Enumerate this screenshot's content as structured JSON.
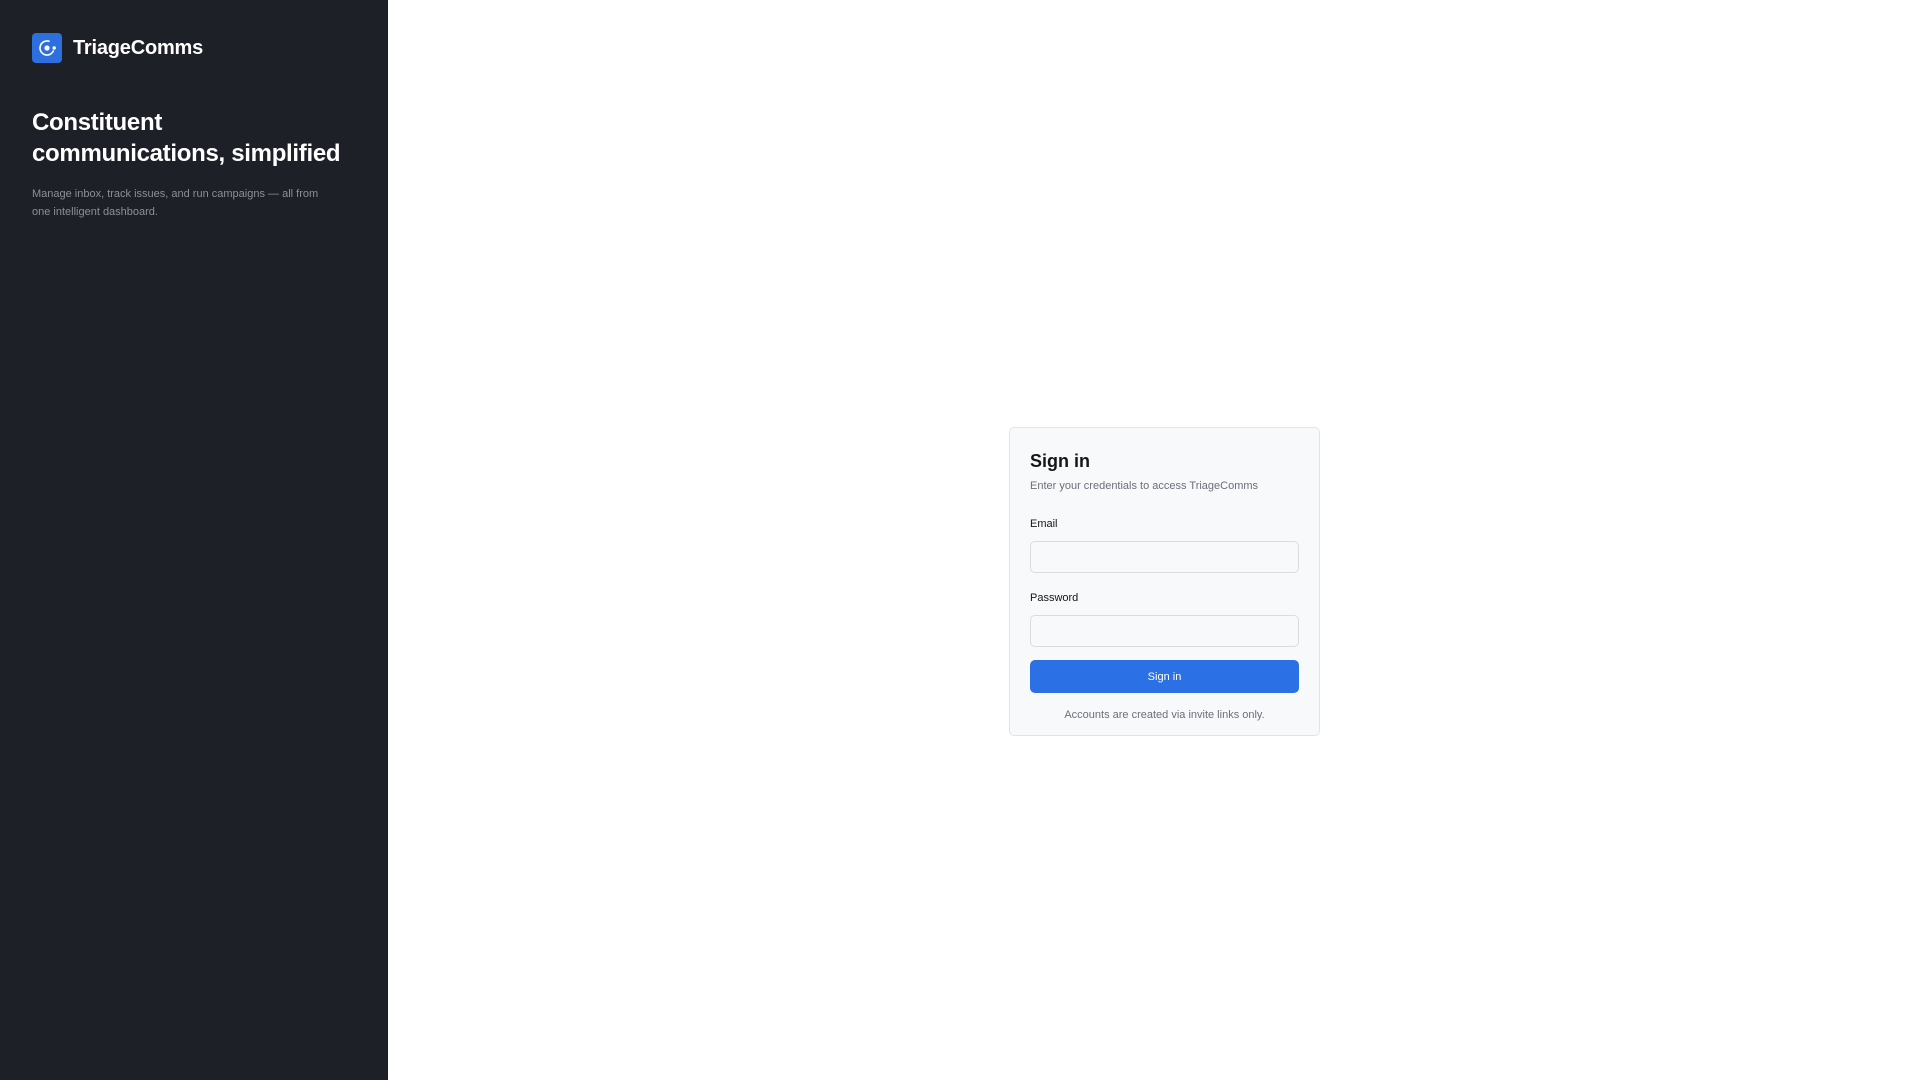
{
  "brand": {
    "app_name": "TriageComms",
    "logo_icon": "target-icon",
    "headline": "Constituent communications, simplified",
    "tagline": "Manage inbox, track issues, and run campaigns — all from one intelligent dashboard.",
    "panel_color": "#1e2028",
    "accent_color": "#2e6fe0"
  },
  "login": {
    "title": "Sign in",
    "subtitle": "Enter your credentials to access TriageComms",
    "email_label": "Email",
    "email_value": "",
    "email_placeholder": "",
    "password_label": "Password",
    "password_value": "",
    "password_placeholder": "",
    "submit_label": "Sign in",
    "footer_note": "Accounts are created via invite links only.",
    "button_color": "#2b70e4"
  }
}
